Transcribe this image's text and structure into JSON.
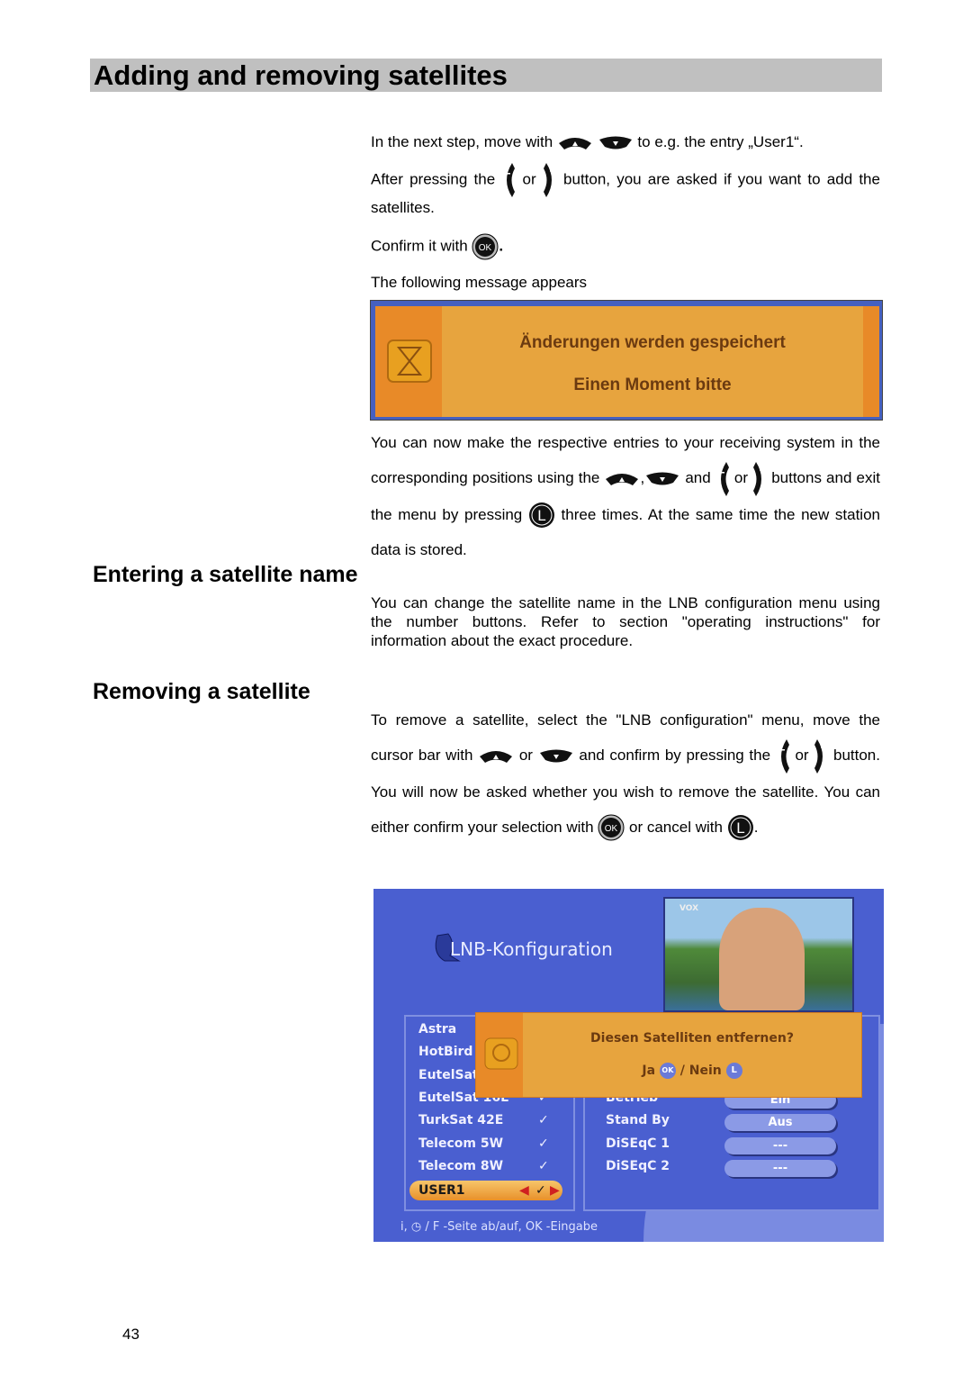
{
  "title": "Adding and removing satellites",
  "p1": {
    "a": "In the next step, move with",
    "b": "to e.g. the entry „User1“."
  },
  "p2": {
    "a": "After pressing the",
    "b": "or",
    "c": "button, you are asked if you want to add the satellites."
  },
  "p3": {
    "a": "Confirm it with",
    "b": "."
  },
  "p4": "The following message appears",
  "message1": {
    "line1": "Änderungen werden gespeichert",
    "line2": "Einen Moment bitte",
    "icon": "hourglass-icon"
  },
  "p5": {
    "a": "You can now make the respective entries to your receiving system in the corresponding positions using the",
    "b": ",",
    "c": "and",
    "d": "or",
    "e": "buttons and exit the menu by pressing",
    "f": "three times. At the same time the new station data is stored."
  },
  "section2": {
    "heading": "Entering a satellite name",
    "text": "You can change the satellite name in the LNB configuration menu using the number buttons. Refer to section \"operating instructions\" for information about the exact procedure."
  },
  "section3": {
    "heading": "Removing a satellite",
    "a": "To remove a satellite, select the \"LNB configuration\" menu, move the cursor bar with",
    "b": "or",
    "c": "and confirm by pressing the",
    "d": "or",
    "e": "button. You will now be asked whether you wish to remove the satellite.  You can either confirm your selection with",
    "f": "or cancel with",
    "g": "."
  },
  "tv": {
    "title": "LNB-Konfiguration",
    "channel_logo": "VOX",
    "satellites": [
      {
        "name": "Astra",
        "checked": ""
      },
      {
        "name": "HotBird",
        "checked": ""
      },
      {
        "name": "EutelSat",
        "checked": ""
      },
      {
        "name": "EutelSat 16E",
        "checked": "✓"
      },
      {
        "name": "TurkSat 42E",
        "checked": "✓"
      },
      {
        "name": "Telecom 5W",
        "checked": "✓"
      },
      {
        "name": "Telecom 8W",
        "checked": "✓"
      }
    ],
    "selected": {
      "name": "USER1",
      "checked": "✓"
    },
    "options": [
      {
        "label": "Betrieb",
        "value": "Ein"
      },
      {
        "label": "Stand By",
        "value": "Aus"
      },
      {
        "label": "DiSEqC 1",
        "value": "---"
      },
      {
        "label": "DiSEqC 2",
        "value": "---"
      }
    ],
    "dialog": {
      "question": "Diesen Satelliten entfernen?",
      "yes": "Ja",
      "slash": "/",
      "no": "Nein",
      "ok_label": "OK",
      "back_label": "L"
    },
    "footer": "i, ◷ / F -Seite ab/auf, OK -Eingabe"
  },
  "page_number": "43",
  "colors": {
    "title_bar": "#c0c0c0",
    "osd_blue": "#4a5fd0",
    "osd_orange": "#e7a43e"
  }
}
